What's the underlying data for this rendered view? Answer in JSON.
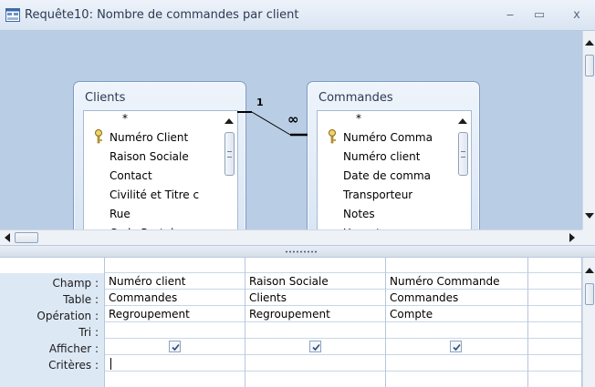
{
  "window": {
    "title": "Requête10: Nombre de commandes par client",
    "minimize_glyph": "‒",
    "maximize_glyph": "▭",
    "close_glyph": "x"
  },
  "tables": [
    {
      "name": "Clients",
      "fields": [
        "*",
        "Numéro Client",
        "Raison Sociale",
        "Contact",
        "Civilité et Titre c",
        "Rue",
        "Code Postal"
      ],
      "key_field_index": 1
    },
    {
      "name": "Commandes",
      "fields": [
        "*",
        "Numéro Comma",
        "Numéro client",
        "Date de comma",
        "Transporteur",
        "Notes",
        "Urgent"
      ],
      "key_field_index": 1
    }
  ],
  "relationship": {
    "one_side": "1",
    "many_side": "∞"
  },
  "grid": {
    "row_labels": {
      "field": "Champ :",
      "table": "Table :",
      "total": "Opération :",
      "sort": "Tri :",
      "show": "Afficher :",
      "criteria": "Critères :"
    },
    "columns": [
      {
        "field": "Numéro client",
        "table": "Commandes",
        "total": "Regroupement",
        "sort": "",
        "show": true,
        "criteria": ""
      },
      {
        "field": "Raison Sociale",
        "table": "Clients",
        "total": "Regroupement",
        "sort": "",
        "show": true,
        "criteria": ""
      },
      {
        "field": "Numéro Commande",
        "table": "Commandes",
        "total": "Compte",
        "sort": "",
        "show": true,
        "criteria": ""
      },
      {
        "field": "",
        "table": "",
        "total": "",
        "sort": "",
        "show": false,
        "criteria": ""
      }
    ]
  },
  "colors": {
    "design_pane": "#b9cde5",
    "row_label_bg": "#dde8f5",
    "accent": "#7f9bc2"
  }
}
